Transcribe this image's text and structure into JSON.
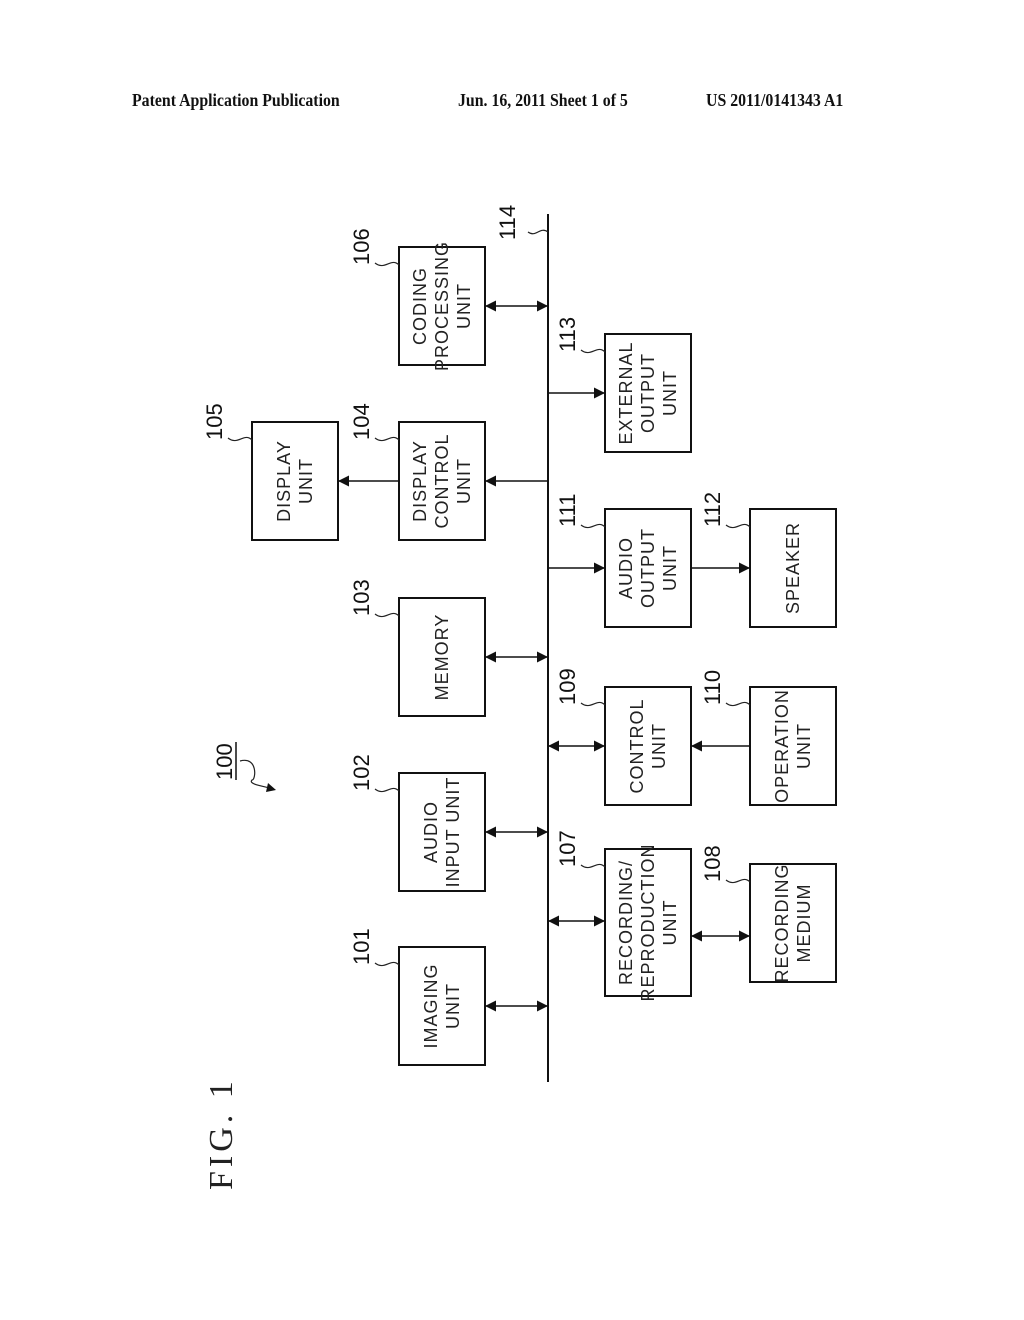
{
  "header": {
    "publication": "Patent Application Publication",
    "date_sheet": "Jun. 16, 2011   Sheet 1 of 5",
    "number": "US 2011/0141343 A1"
  },
  "figure": {
    "label": "FIG. 1",
    "system_ref": "100",
    "bus_ref": "114"
  },
  "blocks": [
    {
      "id": "imaging",
      "ref": "101",
      "lines": [
        "IMAGING",
        "UNIT"
      ]
    },
    {
      "id": "audio-input",
      "ref": "102",
      "lines": [
        "AUDIO",
        "INPUT  UNIT"
      ]
    },
    {
      "id": "memory",
      "ref": "103",
      "lines": [
        "MEMORY"
      ]
    },
    {
      "id": "display-control",
      "ref": "104",
      "lines": [
        "DISPLAY",
        "CONTROL",
        "UNIT"
      ]
    },
    {
      "id": "display",
      "ref": "105",
      "lines": [
        "DISPLAY",
        "UNIT"
      ]
    },
    {
      "id": "coding-processing",
      "ref": "106",
      "lines": [
        "CODING",
        "PROCESSING",
        "UNIT"
      ]
    },
    {
      "id": "recording-reproduction",
      "ref": "107",
      "lines": [
        "RECORDING/",
        "REPRODUCTION",
        "UNIT"
      ]
    },
    {
      "id": "recording-medium",
      "ref": "108",
      "lines": [
        "RECORDING",
        "MEDIUM"
      ]
    },
    {
      "id": "control",
      "ref": "109",
      "lines": [
        "CONTROL",
        "UNIT"
      ]
    },
    {
      "id": "operation",
      "ref": "110",
      "lines": [
        "OPERATION",
        "UNIT"
      ]
    },
    {
      "id": "audio-output",
      "ref": "111",
      "lines": [
        "AUDIO",
        "OUTPUT",
        "UNIT"
      ]
    },
    {
      "id": "speaker",
      "ref": "112",
      "lines": [
        "SPEAKER"
      ]
    },
    {
      "id": "external-output",
      "ref": "113",
      "lines": [
        "EXTERNAL",
        "OUTPUT",
        "UNIT"
      ]
    }
  ],
  "connections": [
    {
      "from": "imaging",
      "to": "bus",
      "type": "bidirectional"
    },
    {
      "from": "audio-input",
      "to": "bus",
      "type": "bidirectional"
    },
    {
      "from": "memory",
      "to": "bus",
      "type": "bidirectional"
    },
    {
      "from": "bus",
      "to": "display-control",
      "type": "directed"
    },
    {
      "from": "display-control",
      "to": "display",
      "type": "directed"
    },
    {
      "from": "coding-processing",
      "to": "bus",
      "type": "bidirectional"
    },
    {
      "from": "recording-reproduction",
      "to": "bus",
      "type": "bidirectional"
    },
    {
      "from": "recording-reproduction",
      "to": "recording-medium",
      "type": "bidirectional"
    },
    {
      "from": "control",
      "to": "bus",
      "type": "bidirectional"
    },
    {
      "from": "operation",
      "to": "control",
      "type": "directed"
    },
    {
      "from": "bus",
      "to": "audio-output",
      "type": "directed"
    },
    {
      "from": "audio-output",
      "to": "speaker",
      "type": "directed"
    },
    {
      "from": "bus",
      "to": "external-output",
      "type": "directed"
    }
  ]
}
